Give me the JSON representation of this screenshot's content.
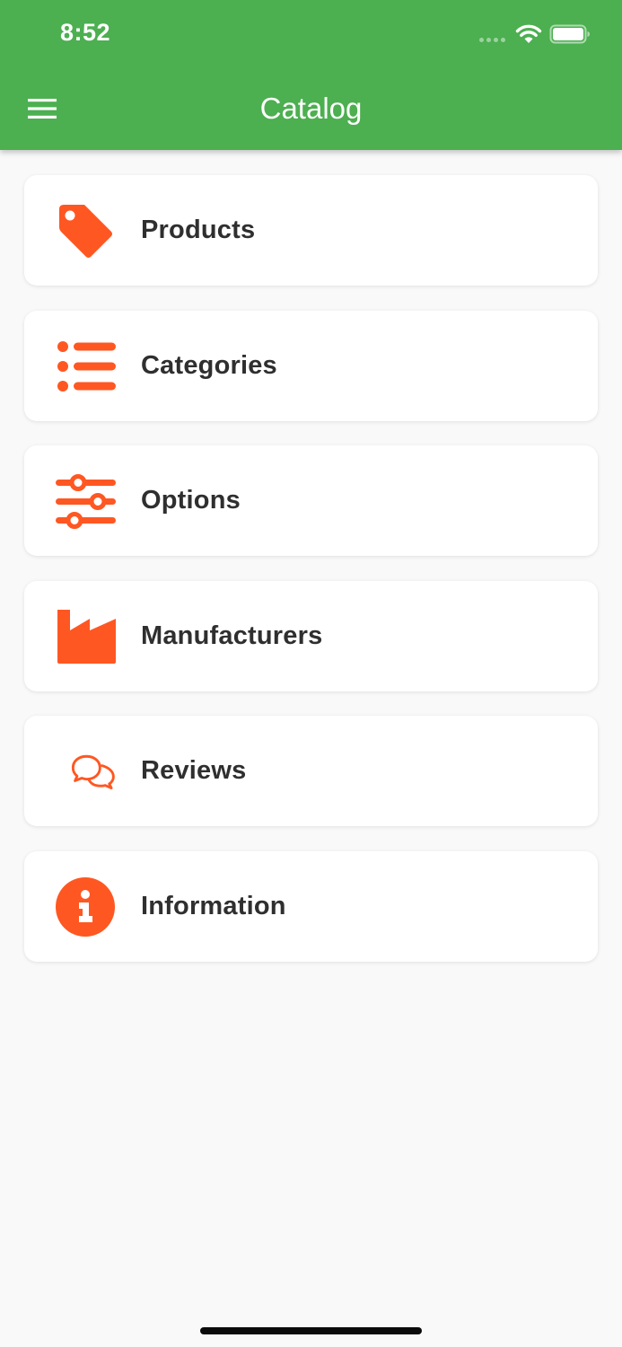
{
  "status_bar": {
    "time": "8:52"
  },
  "appbar": {
    "title": "Catalog",
    "menu_icon": "hamburger-menu-icon",
    "color": "#4caf50"
  },
  "accent_color": "#ff5722",
  "items": [
    {
      "label": "Products",
      "icon": "tag-icon"
    },
    {
      "label": "Categories",
      "icon": "list-icon"
    },
    {
      "label": "Options",
      "icon": "sliders-icon"
    },
    {
      "label": "Manufacturers",
      "icon": "factory-icon"
    },
    {
      "label": "Reviews",
      "icon": "chat-bubbles-icon"
    },
    {
      "label": "Information",
      "icon": "info-circle-icon"
    }
  ]
}
